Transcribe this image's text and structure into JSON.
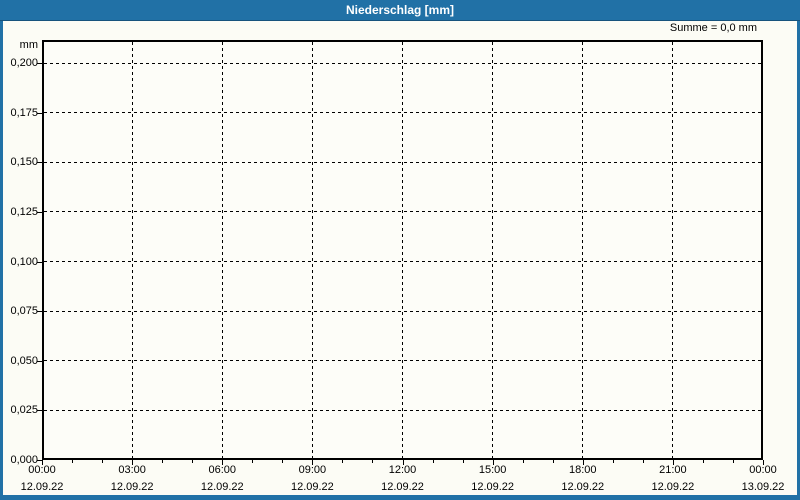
{
  "window": {
    "title": "Niederschlag [mm]"
  },
  "header": {
    "summary": "Summe = 0,0 mm"
  },
  "colors": {
    "titlebar_bg": "#2171a6",
    "titlebar_text": "#ffffff",
    "window_frame": "#2171a6",
    "page_bg": "#fcfcf5",
    "plot_bg": "#fdfdf8",
    "axis": "#000000",
    "gridline": "#000000",
    "label_text": "#000000"
  },
  "chart_data": {
    "type": "line",
    "title": "Niederschlag [mm]",
    "ylabel": "mm",
    "xlabel": "",
    "annotation": "Summe = 0,0 mm",
    "legend_position": "none",
    "grid": {
      "style": "dashed",
      "horizontal": true,
      "vertical": true
    },
    "x_axis": {
      "major_tick_interval_hours": 3,
      "minor_tick_interval_hours": 1,
      "total_hours": 24,
      "ticks": [
        {
          "time": "00:00",
          "date": "12.09.22"
        },
        {
          "time": "03:00",
          "date": "12.09.22"
        },
        {
          "time": "06:00",
          "date": "12.09.22"
        },
        {
          "time": "09:00",
          "date": "12.09.22"
        },
        {
          "time": "12:00",
          "date": "12.09.22"
        },
        {
          "time": "15:00",
          "date": "12.09.22"
        },
        {
          "time": "18:00",
          "date": "12.09.22"
        },
        {
          "time": "21:00",
          "date": "12.09.22"
        },
        {
          "time": "00:00",
          "date": "13.09.22"
        }
      ]
    },
    "y_axis": {
      "unit": "mm",
      "min": 0.0,
      "max_label": 0.2,
      "headroom": 0.0116,
      "ticks": [
        {
          "label": "0,200",
          "value": 0.2
        },
        {
          "label": "0,175",
          "value": 0.175
        },
        {
          "label": "0,150",
          "value": 0.15
        },
        {
          "label": "0,125",
          "value": 0.125
        },
        {
          "label": "0,100",
          "value": 0.1
        },
        {
          "label": "0,075",
          "value": 0.075
        },
        {
          "label": "0,050",
          "value": 0.05
        },
        {
          "label": "0,025",
          "value": 0.025
        },
        {
          "label": "0,000",
          "value": 0.0
        }
      ]
    },
    "series": [
      {
        "name": "Niederschlag",
        "sum_mm": "0,0",
        "values": [
          0,
          0,
          0,
          0,
          0,
          0,
          0,
          0,
          0
        ]
      }
    ]
  }
}
